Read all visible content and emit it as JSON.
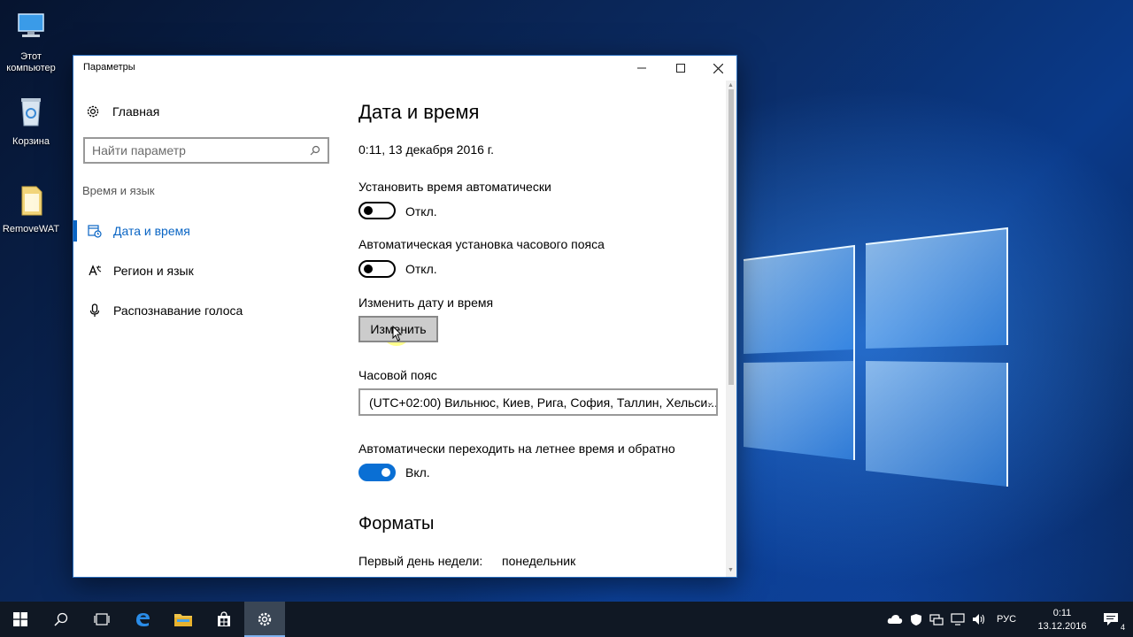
{
  "desktop": {
    "icons": [
      {
        "label": "Этот компьютер"
      },
      {
        "label": "Корзина"
      },
      {
        "label": "RemoveWAT"
      }
    ]
  },
  "window": {
    "title": "Параметры",
    "minimize": "—",
    "maximize": "☐",
    "close": "✕"
  },
  "sidebar": {
    "home_label": "Главная",
    "search_placeholder": "Найти параметр",
    "group_label": "Время и язык",
    "items": [
      {
        "label": "Дата и время",
        "icon": "clock-calendar-icon",
        "active": true
      },
      {
        "label": "Регион и язык",
        "icon": "language-icon",
        "active": false
      },
      {
        "label": "Распознавание голоса",
        "icon": "microphone-icon",
        "active": false
      }
    ]
  },
  "main": {
    "title": "Дата и время",
    "current_datetime": "0:11, 13 декабря 2016 г.",
    "auto_time": {
      "label": "Установить время автоматически",
      "state": "Откл.",
      "on": false
    },
    "auto_timezone": {
      "label": "Автоматическая установка часового пояса",
      "state": "Откл.",
      "on": false
    },
    "change_datetime": {
      "label": "Изменить дату и время",
      "button": "Изменить"
    },
    "timezone": {
      "label": "Часовой пояс",
      "value": "(UTC+02:00) Вильнюс, Киев, Рига, София, Таллин, Хельси..."
    },
    "dst": {
      "label": "Автоматически переходить на летнее время и обратно",
      "state": "Вкл.",
      "on": true
    },
    "formats": {
      "title": "Форматы",
      "first_day_label": "Первый день недели:",
      "first_day_value": "понедельник"
    }
  },
  "taskbar": {
    "language": "РУС",
    "time": "0:11",
    "date": "13.12.2016",
    "notification_count": "4"
  },
  "colors": {
    "accent": "#0a65c4",
    "toggle_on": "#0a6fd4",
    "taskbar": "#101824"
  }
}
